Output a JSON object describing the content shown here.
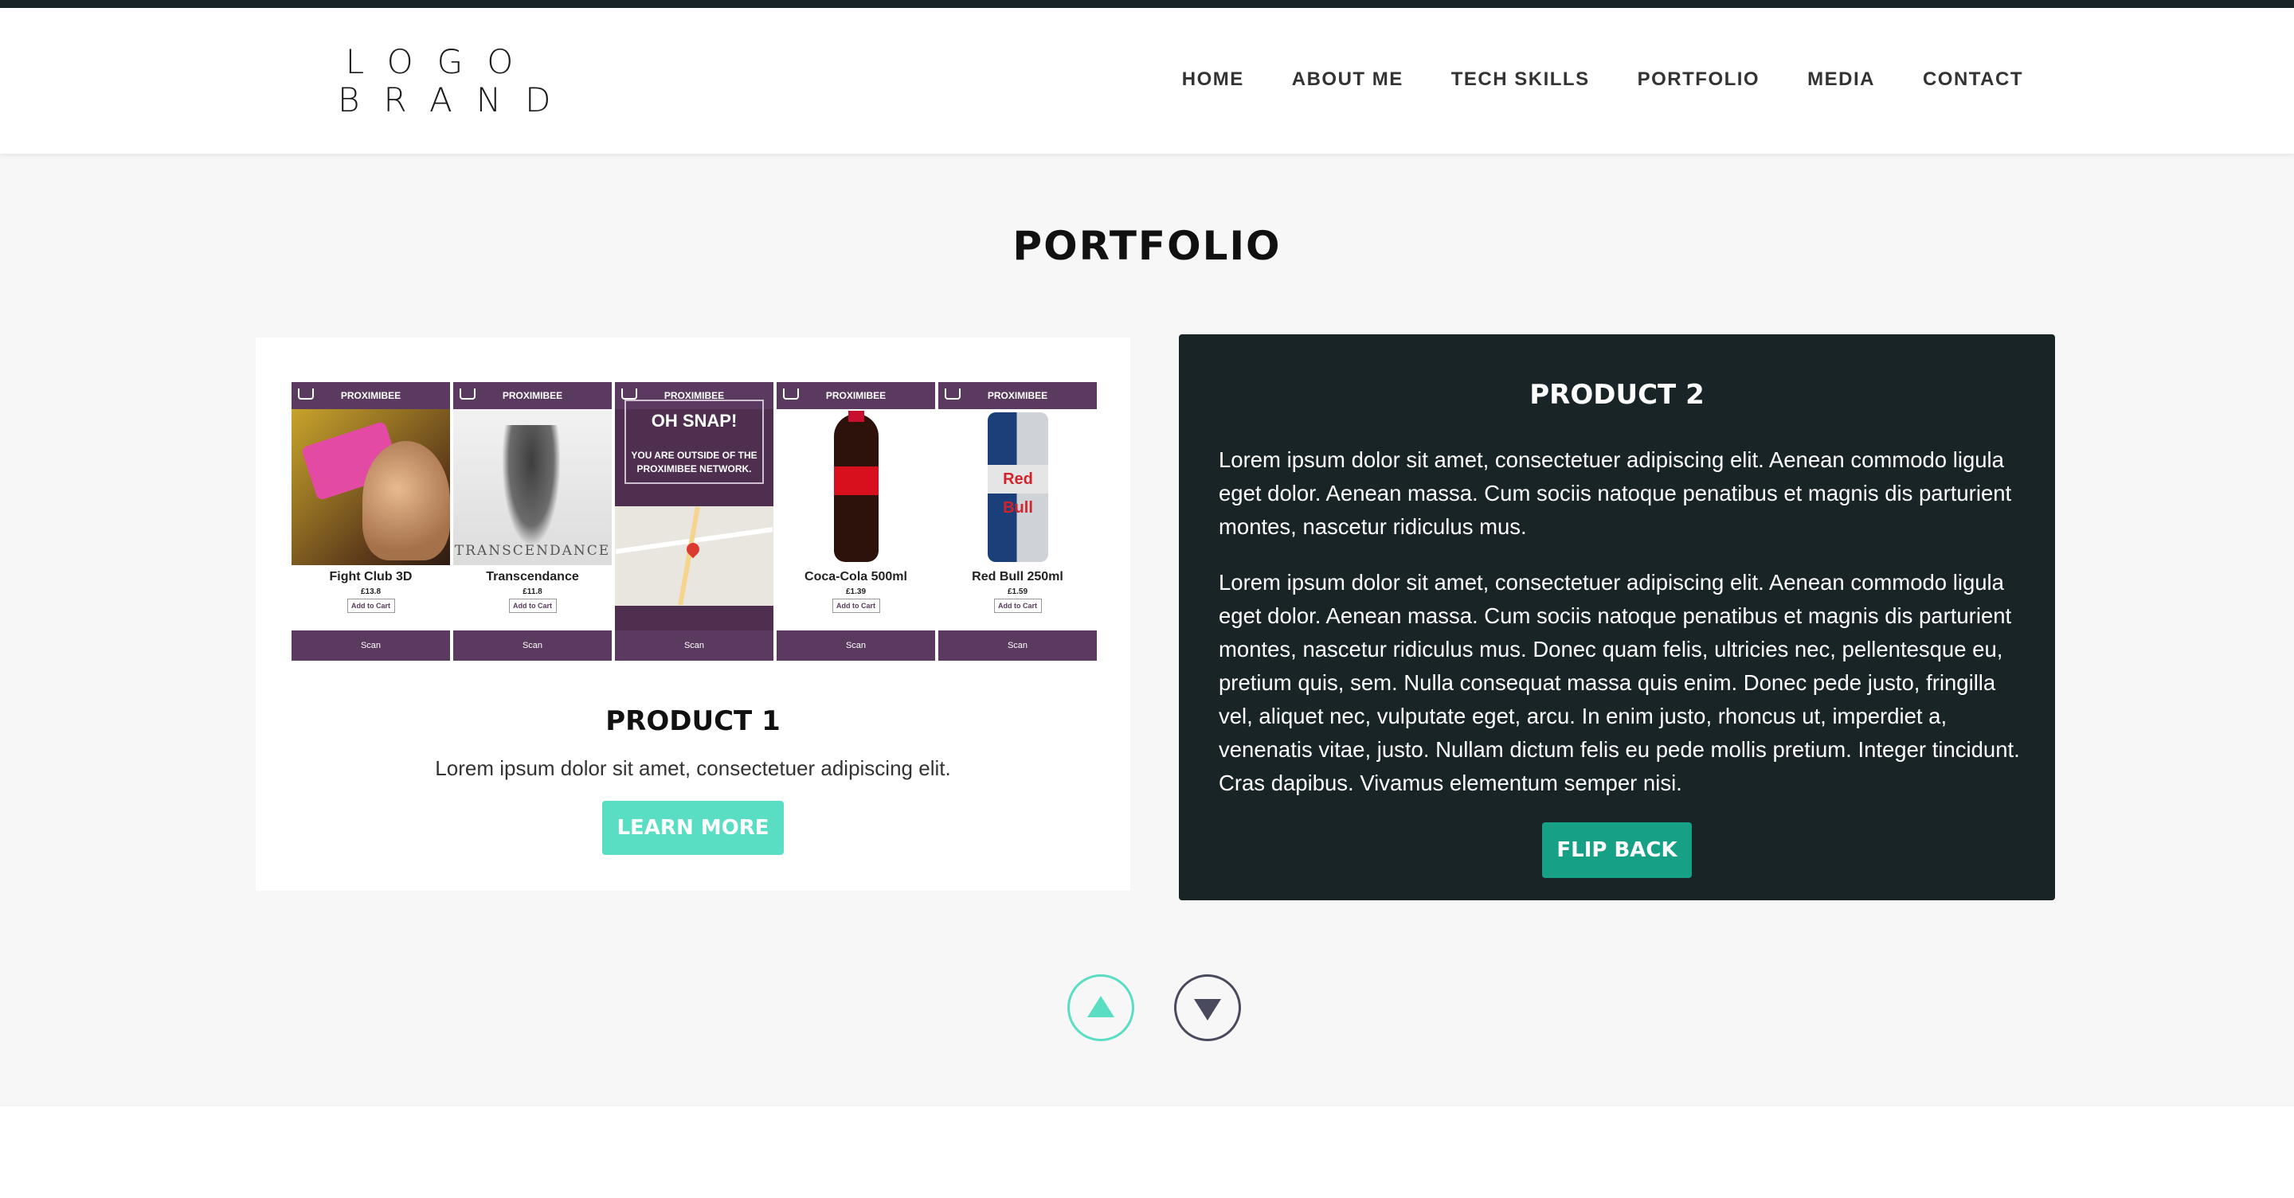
{
  "brand": {
    "line1": "LOGO",
    "line2": "BRAND"
  },
  "nav": {
    "items": [
      "HOME",
      "ABOUT ME",
      "TECH SKILLS",
      "PORTFOLIO",
      "MEDIA",
      "CONTACT"
    ]
  },
  "section": {
    "title": "PORTFOLIO"
  },
  "product1": {
    "title": "PRODUCT 1",
    "description": "Lorem ipsum dolor sit amet, consectetuer adipiscing elit.",
    "button_label": "LEARN MORE",
    "screens": [
      {
        "header": "PROXIMIBEE",
        "name": "Fight Club 3D",
        "price": "£13.8",
        "add_label": "Add to Cart",
        "scan": "Scan"
      },
      {
        "header": "PROXIMIBEE",
        "name": "Transcendance",
        "price": "£11.8",
        "add_label": "Add to Cart",
        "scan": "Scan",
        "poster_title": "TRANSCENDANCE"
      },
      {
        "header": "PROXIMIBEE",
        "alert_big": "OH SNAP!",
        "alert_small": "YOU ARE OUTSIDE OF THE PROXIMIBEE NETWORK.",
        "scan": "Scan"
      },
      {
        "header": "PROXIMIBEE",
        "name": "Coca-Cola 500ml",
        "price": "£1.39",
        "add_label": "Add to Cart",
        "scan": "Scan"
      },
      {
        "header": "PROXIMIBEE",
        "name": "Red Bull 250ml",
        "price": "£1.59",
        "add_label": "Add to Cart",
        "scan": "Scan",
        "can_label": "Red Bull"
      }
    ]
  },
  "product2": {
    "title": "PRODUCT 2",
    "paragraph1": "Lorem ipsum dolor sit amet, consectetuer adipiscing elit. Aenean commodo ligula eget dolor. Aenean massa. Cum sociis natoque penatibus et magnis dis parturient montes, nascetur ridiculus mus.",
    "paragraph2": "Lorem ipsum dolor sit amet, consectetuer adipiscing elit. Aenean commodo ligula eget dolor. Aenean massa. Cum sociis natoque penatibus et magnis dis parturient montes, nascetur ridiculus mus. Donec quam felis, ultricies nec, pellentesque eu, pretium quis, sem. Nulla consequat massa quis enim. Donec pede justo, fringilla vel, aliquet nec, vulputate eget, arcu. In enim justo, rhoncus ut, imperdiet a, venenatis vitae, justo. Nullam dictum felis eu pede mollis pretium. Integer tincidunt. Cras dapibus. Vivamus elementum semper nisi.",
    "button_label": "FLIP BACK"
  },
  "pager": {
    "up_icon": "triangle-up-icon",
    "down_icon": "triangle-down-icon"
  },
  "colors": {
    "accent": "#59dec4",
    "accent_dark": "#16a085",
    "dark_card": "#182426",
    "app_purple": "#5a3a5e"
  }
}
